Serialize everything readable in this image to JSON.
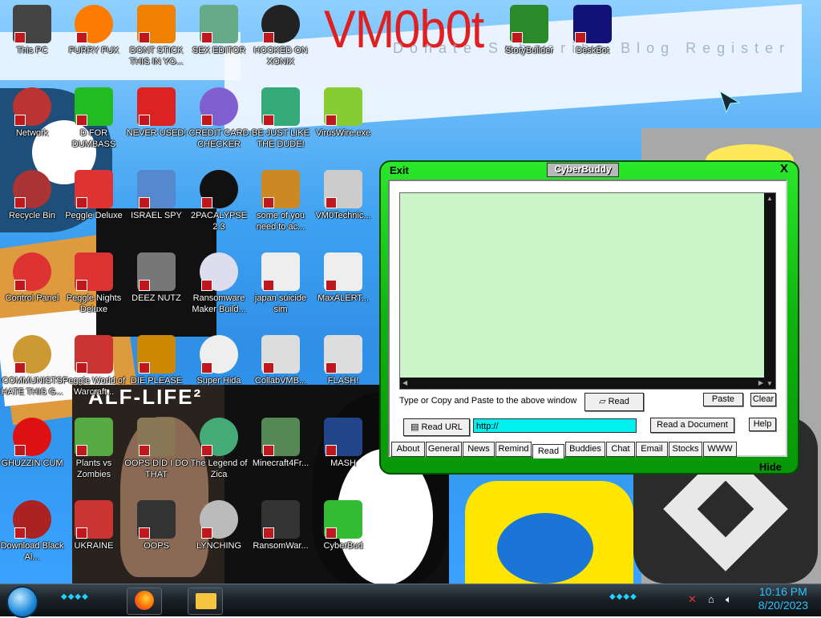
{
  "wallpaper": {
    "title": "VM0b0t",
    "faint_text": "Donate  Subscribe  Blog  Register",
    "game_text": "ALF-LIFE²"
  },
  "desktop_icons": [
    {
      "label": "This PC",
      "icon": "computer-icon"
    },
    {
      "label": "FURRY FUX",
      "icon": "firefox-icon"
    },
    {
      "label": "DONT STICK THIS IN YO...",
      "icon": "vlc-icon"
    },
    {
      "label": "SEX EDITOR",
      "icon": "hxd-editor-icon"
    },
    {
      "label": "HOOKED ON XONIX",
      "icon": "xonix-icon"
    },
    {
      "label": "StoryBuilder",
      "icon": "storybuilder-icon"
    },
    {
      "label": "DeskBot",
      "icon": "deskbot-icon"
    },
    {
      "label": "Network",
      "icon": "network-icon"
    },
    {
      "label": "D FOR DUMBASS",
      "icon": "chat-icon"
    },
    {
      "label": "NEVER USED!",
      "icon": "devcpp-icon"
    },
    {
      "label": "CREDIT CARD CHECKER",
      "icon": "credit-card-icon"
    },
    {
      "label": "BE JUST LIKE THE DUDE!",
      "icon": "elf-icon"
    },
    {
      "label": "VirusWire.exe",
      "icon": "lime-icon"
    },
    {
      "label": "Recycle Bin",
      "icon": "recycle-bin-icon"
    },
    {
      "label": "Peggle Deluxe",
      "icon": "peggle-icon"
    },
    {
      "label": "ISRAEL SPY",
      "icon": "spy-icon"
    },
    {
      "label": "2PACALYPSE 2.3",
      "icon": "terminal-icon"
    },
    {
      "label": "some of you need to ac...",
      "icon": "dog-icon"
    },
    {
      "label": "VM0Technic...",
      "icon": "doctor-icon"
    },
    {
      "label": "Control Panel",
      "icon": "control-panel-icon"
    },
    {
      "label": "Peggle Nights Deluxe",
      "icon": "peggle-icon"
    },
    {
      "label": "DEEZ NUTZ",
      "icon": "window-stack-icon"
    },
    {
      "label": "Ransomware Maker Build...",
      "icon": "app-window-icon"
    },
    {
      "label": "japan suicide sim",
      "icon": "suicide-sim-icon"
    },
    {
      "label": "MaxALERT...",
      "icon": "max-alert-icon"
    },
    {
      "label": "COMMUNISTS HATE THIS G...",
      "icon": "money-bag-icon"
    },
    {
      "label": "Peggle World of Warcraft...",
      "icon": "peggle-icon"
    },
    {
      "label": "DIE PLEASE",
      "icon": "de-icon"
    },
    {
      "label": "Super Hida",
      "icon": "pixel-cat-icon"
    },
    {
      "label": "CollabVMB...",
      "icon": "collabvm-icon"
    },
    {
      "label": "FLASH!",
      "icon": "flash-icon"
    },
    {
      "label": "GHUZZIN CUM",
      "icon": "red-blob-icon"
    },
    {
      "label": "Plants vs Zombies",
      "icon": "plant-icon"
    },
    {
      "label": "OOPS DID I DO THAT",
      "icon": "painting-icon"
    },
    {
      "label": "The Legend of Zica",
      "icon": "zica-icon"
    },
    {
      "label": "Minecraft4Fr...",
      "icon": "minecraft-icon"
    },
    {
      "label": "MASH",
      "icon": "hat-icon"
    },
    {
      "label": "Download Black Al...",
      "icon": "black-ali-icon"
    },
    {
      "label": "UKRAINE",
      "icon": "radiation-icon"
    },
    {
      "label": "OOPS",
      "icon": "oops-icon"
    },
    {
      "label": "LYNCHING",
      "icon": "noose-icon"
    },
    {
      "label": "RansomWar...",
      "icon": "skull-icon"
    },
    {
      "label": "CyberBud",
      "icon": "cyberbud-icon"
    }
  ],
  "cyberbuddy": {
    "exit": "Exit",
    "title": "CyberBuddy",
    "close": "X",
    "hide": "Hide",
    "text_content": "",
    "hint": "Type or Copy and Paste to the above window",
    "read_button": "Read",
    "paste_button": "Paste",
    "clear_button": "Clear",
    "read_url_button": "Read URL",
    "url_value": "http://",
    "read_document_button": "Read a Document",
    "help_button": "Help",
    "tabs": [
      "About",
      "General",
      "News",
      "Remind",
      "Read",
      "Buddies",
      "Chat",
      "Email",
      "Stocks",
      "WWW"
    ],
    "active_tab": "Read",
    "accent": "#1ed21e"
  },
  "taskbar": {
    "apps": [
      "firefox-icon",
      "file-explorer-icon"
    ],
    "time": "10:16 PM",
    "date": "8/20/2023",
    "tray_icons": [
      "network-error-icon",
      "network-icon",
      "volume-icon"
    ],
    "accent": "#2fc3ff"
  }
}
